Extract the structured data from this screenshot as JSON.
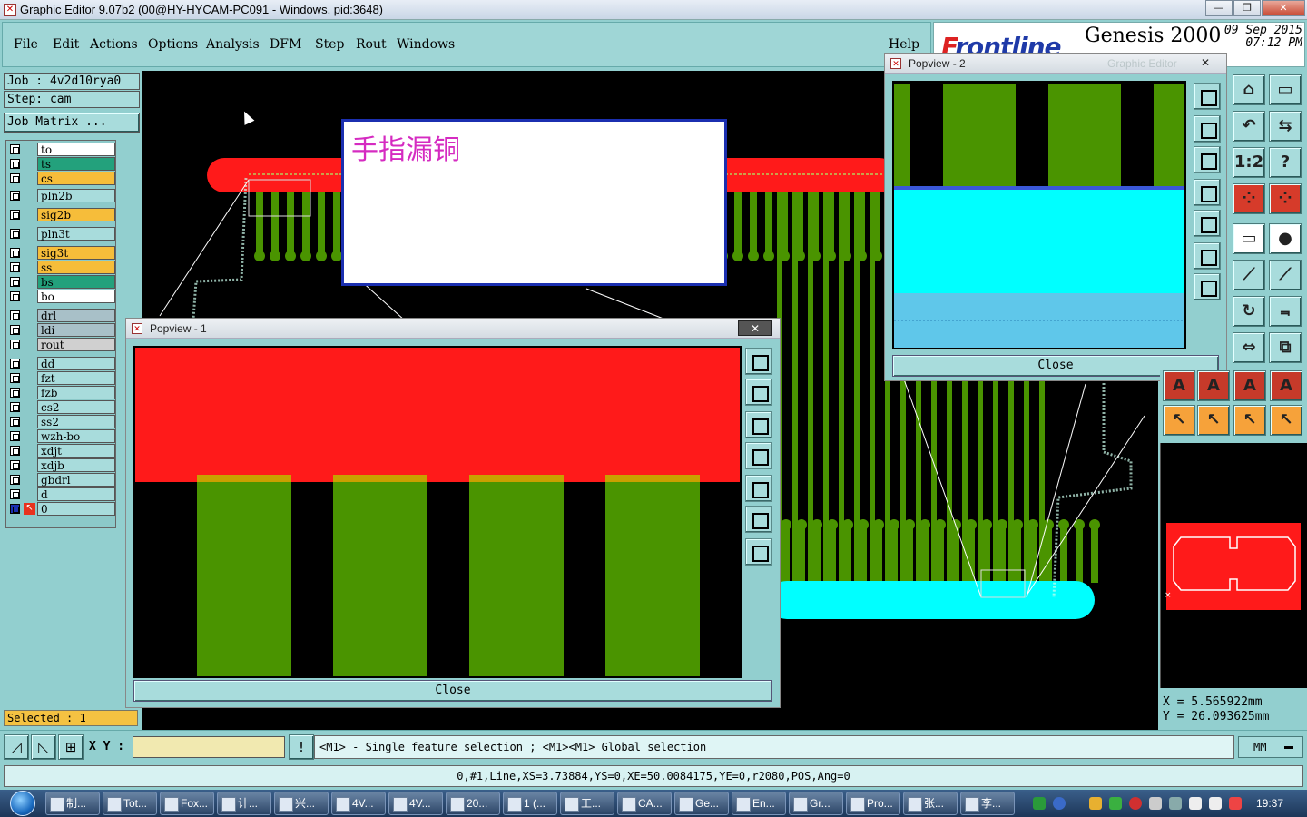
{
  "window": {
    "title": "Graphic Editor 9.07b2 (00@HY-HYCAM-PC091 - Windows, pid:3648)",
    "min_glyph": "—",
    "max_glyph": "❐",
    "close_glyph": "✕"
  },
  "menu": {
    "items": [
      "File",
      "Edit",
      "Actions",
      "Options",
      "Analysis",
      "DFM",
      "Step",
      "Rout",
      "Windows"
    ],
    "help": "Help"
  },
  "brand": {
    "logo": "Frontline",
    "product": "Genesis 2000",
    "date": "09 Sep 2015",
    "time": "07:12 PM"
  },
  "job": {
    "job_line": "Job : 4v2d10rya0",
    "step_line": "Step: cam",
    "matrix_button": "Job Matrix ..."
  },
  "layers": [
    {
      "name": "to",
      "color": "#ffffff"
    },
    {
      "name": "ts",
      "color": "#23a17c"
    },
    {
      "name": "cs",
      "color": "#f6bd3a"
    },
    {
      "name": "pln2b",
      "color": "#a8dcdc"
    },
    {
      "name": "sig2b",
      "color": "#f6bd3a"
    },
    {
      "name": "pln3t",
      "color": "#a8dcdc"
    },
    {
      "name": "sig3t",
      "color": "#f6bd3a"
    },
    {
      "name": "ss",
      "color": "#f6bd3a"
    },
    {
      "name": "bs",
      "color": "#23a17c"
    },
    {
      "name": "bo",
      "color": "#ffffff"
    },
    {
      "name": "drl",
      "color": "#a8c0c8"
    },
    {
      "name": "ldi",
      "color": "#a8c0c8"
    },
    {
      "name": "rout",
      "color": "#d0d0d0"
    },
    {
      "name": "dd",
      "color": "#a8dcdc"
    },
    {
      "name": "fzt",
      "color": "#a8dcdc"
    },
    {
      "name": "fzb",
      "color": "#a8dcdc"
    },
    {
      "name": "cs2",
      "color": "#a8dcdc"
    },
    {
      "name": "ss2",
      "color": "#a8dcdc"
    },
    {
      "name": "wzh-bo",
      "color": "#a8dcdc"
    },
    {
      "name": "xdjt",
      "color": "#a8dcdc"
    },
    {
      "name": "xdjb",
      "color": "#a8dcdc"
    },
    {
      "name": "gbdrl",
      "color": "#a8dcdc"
    },
    {
      "name": "d",
      "color": "#a8dcdc"
    },
    {
      "name": "0",
      "color": "#a8dcdc"
    }
  ],
  "selected_text": "Selected : 1",
  "note_text": "手指漏铜",
  "popview1": {
    "title": "Popview - 1",
    "close_label": "Close",
    "close_glyph": "✕"
  },
  "popview2": {
    "title": "Popview - 2",
    "close_label": "Close",
    "close_glyph": "✕",
    "ghost": "Graphic Editor"
  },
  "toolbar_glyphs": [
    "⌂",
    "▭",
    "↶",
    "⇆",
    "1:2",
    "?",
    "⁘",
    "⁘",
    "▭",
    "●",
    "⟋",
    "⟋",
    "↻",
    "⫬",
    "⇔",
    "⧉",
    "A",
    "A",
    "↖",
    "↖",
    "↖",
    "↖"
  ],
  "coords": {
    "x": "X = 5.565922mm",
    "y": "Y = 26.093625mm"
  },
  "xy_label": "X Y :",
  "hint": "<M1> - Single feature selection ; <M1><M1> Global selection",
  "units": "MM",
  "status": "0,#1,Line,XS=3.73884,YS=0,XE=50.0084175,YE=0,r2080,POS,Ang=0",
  "taskbar": {
    "tasks": [
      "制...",
      "Tot...",
      "Fox...",
      "计...",
      "兴...",
      "4V...",
      "4V...",
      "20...",
      "1 (...",
      "工...",
      "CA...",
      "Ge...",
      "En...",
      "Gr...",
      "Pro...",
      "张...",
      "李..."
    ],
    "clock": "19:37"
  },
  "colors": {
    "copper_red": "#ff1a1a",
    "trace_green": "#4a9400",
    "cyan": "#00ffff",
    "note_border": "#1b2fb0",
    "note_text": "#d52bc1"
  }
}
